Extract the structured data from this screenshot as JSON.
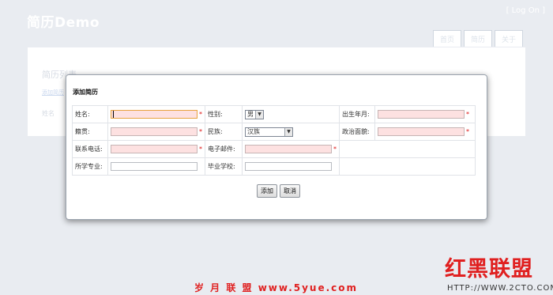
{
  "app": {
    "title": "简历Demo",
    "login": "[ Log On ]",
    "tabs": [
      "首页",
      "简历",
      "关于"
    ]
  },
  "background_panel": {
    "title": "简历列表",
    "link": "添加简历",
    "column": "姓名"
  },
  "dialog": {
    "title": "添加简历",
    "fields": {
      "name": {
        "label": "姓名:"
      },
      "gender": {
        "label": "性别:",
        "value": "男"
      },
      "birth": {
        "label": "出生年月:"
      },
      "native": {
        "label": "籍贯:"
      },
      "ethnicity": {
        "label": "民族:",
        "value": "汉族"
      },
      "political": {
        "label": "政治面貌:"
      },
      "phone": {
        "label": "联系电话:"
      },
      "email": {
        "label": "电子邮件:"
      },
      "major": {
        "label": "所学专业:"
      },
      "school": {
        "label": "毕业学校:"
      }
    },
    "required_mark": "*",
    "buttons": {
      "add": "添加",
      "cancel": "取消"
    }
  },
  "watermarks": {
    "left": "岁 月 联 盟  www.5yue.com",
    "logo": "红黑联盟",
    "url": "HTTP://WWW.2CTO.COM"
  },
  "colors": {
    "required_bg": "#fde1e1",
    "required_star": "#dd1111",
    "focus_border": "#e8a23e",
    "watermark": "#e02020"
  }
}
